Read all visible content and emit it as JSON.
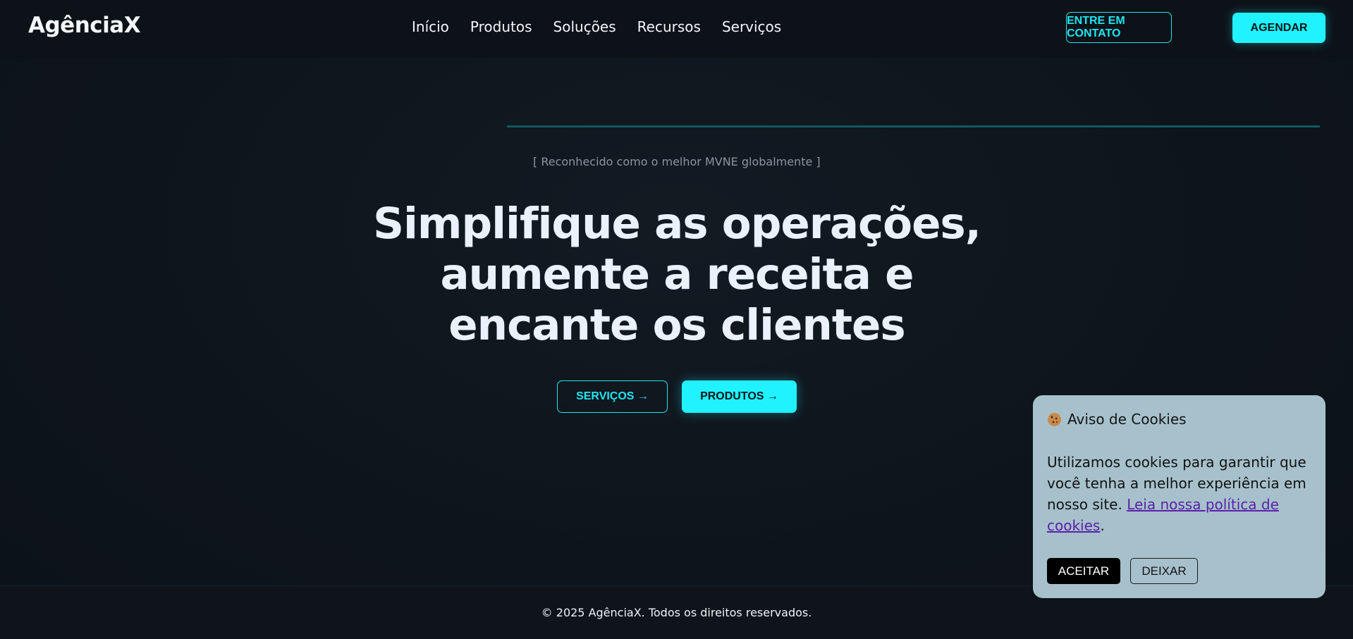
{
  "header": {
    "logo": "AgênciaX",
    "nav": [
      "Início",
      "Produtos",
      "Soluções",
      "Recursos",
      "Serviços"
    ],
    "contact_button": "ENTRE EM CONTATO",
    "schedule_button": "AGENDAR"
  },
  "hero": {
    "tagline": "[ Reconhecido como o melhor MVNE globalmente ]",
    "title_lines": [
      "Simplifique as operações,",
      "aumente a receita e",
      "encante os clientes"
    ],
    "services_button": "SERVIÇOS →",
    "products_button": "PRODUTOS →"
  },
  "cookie": {
    "icon": "cookie-icon",
    "title": "Aviso de Cookies",
    "text": "Utilizamos cookies para garantir que você tenha a melhor experiência em nosso site.",
    "link": "Leia nossa política de cookies",
    "trailing": ".",
    "accept": "ACEITAR",
    "decline": "DEIXAR"
  },
  "footer": {
    "text": "© 2025 AgênciaX. Todos os direitos reservados."
  },
  "colors": {
    "accent": "#20f2ff",
    "background": "#0f151d",
    "cookie_bg": "#a6c1cc",
    "link": "#5b1fa8"
  }
}
